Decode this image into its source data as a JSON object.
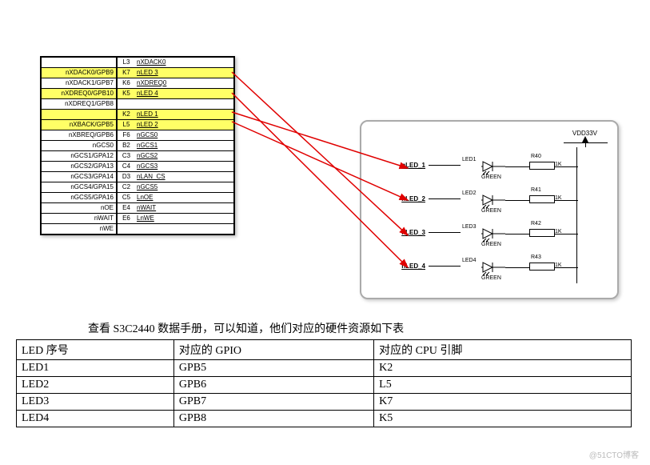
{
  "pin_rows": [
    {
      "left": "",
      "mid": "L3",
      "right": "nXDACK0",
      "hl": false
    },
    {
      "left": "nXDACK0/GPB9",
      "mid": "K7",
      "right": "nLED 3",
      "hl": true
    },
    {
      "left": "nXDACK1/GPB7",
      "mid": "K6",
      "right": "nXDREQ0",
      "hl": false
    },
    {
      "left": "nXDREQ0/GPB10",
      "mid": "K5",
      "right": "nLED 4",
      "hl": true
    },
    {
      "left": "nXDREQ1/GPB8",
      "mid": "",
      "right": "",
      "hl": false
    },
    {
      "left": "",
      "mid": "K2",
      "right": "nLED 1",
      "hl": true
    },
    {
      "left": "nXBACK/GPB5",
      "mid": "L5",
      "right": "nLED 2",
      "hl": true
    },
    {
      "left": "nXBREQ/GPB6",
      "mid": "F6",
      "right": "nGCS0",
      "hl": false
    },
    {
      "left": "nGCS0",
      "mid": "B2",
      "right": "nGCS1",
      "hl": false
    },
    {
      "left": "nGCS1/GPA12",
      "mid": "C3",
      "right": "nGCS2",
      "hl": false
    },
    {
      "left": "nGCS2/GPA13",
      "mid": "C4",
      "right": "nGCS3",
      "hl": false
    },
    {
      "left": "nGCS3/GPA14",
      "mid": "D3",
      "right": "nLAN_CS",
      "hl": false
    },
    {
      "left": "nGCS4/GPA15",
      "mid": "C2",
      "right": "nGCS5",
      "hl": false
    },
    {
      "left": "nGCS5/GPA16",
      "mid": "C5",
      "right": "LnOE",
      "hl": false
    },
    {
      "left": "nOE",
      "mid": "E4",
      "right": "nWAIT",
      "hl": false
    },
    {
      "left": "nWAIT",
      "mid": "E6",
      "right": "LnWE",
      "hl": false
    },
    {
      "left": "nWE",
      "mid": "",
      "right": "",
      "hl": false
    }
  ],
  "led_circuit": {
    "vdd": "VDD33V",
    "color": "GREEN",
    "rows": [
      {
        "sig": "nLED_1",
        "led": "LED1",
        "r": "R40",
        "rv": "1K"
      },
      {
        "sig": "nLED_2",
        "led": "LED2",
        "r": "R41",
        "rv": "1K"
      },
      {
        "sig": "nLED_3",
        "led": "LED3",
        "r": "R42",
        "rv": "1K"
      },
      {
        "sig": "nLED_4",
        "led": "LED4",
        "r": "R43",
        "rv": "1K"
      }
    ]
  },
  "caption": "查看 S3C2440 数据手册，可以知道，他们对应的硬件资源如下表",
  "table": {
    "headers": [
      "LED 序号",
      "对应的 GPIO",
      "对应的 CPU 引脚"
    ],
    "rows": [
      [
        "LED1",
        "GPB5",
        "K2"
      ],
      [
        "LED2",
        "GPB6",
        "L5"
      ],
      [
        "LED3",
        "GPB7",
        "K7"
      ],
      [
        "LED4",
        "GPB8",
        "K5"
      ]
    ]
  },
  "watermark": "@51CTO博客"
}
